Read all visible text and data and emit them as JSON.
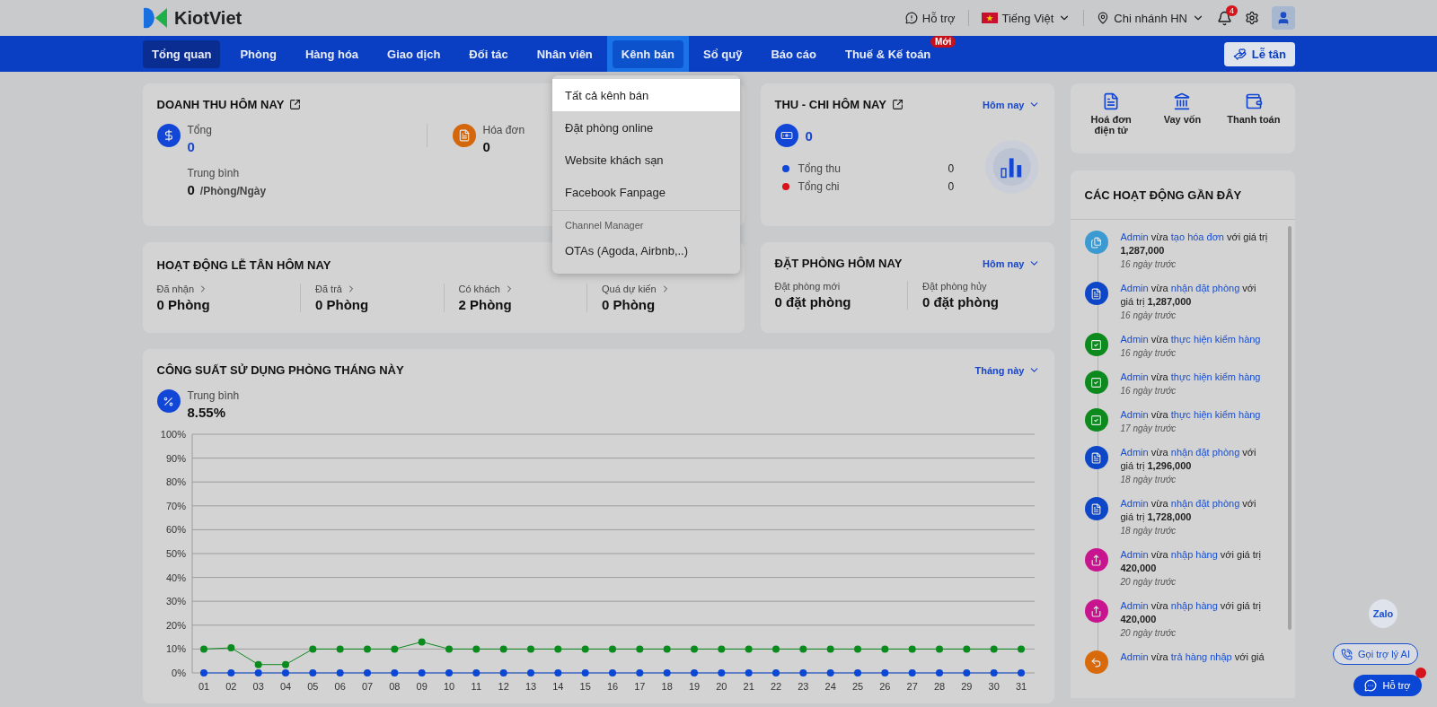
{
  "header": {
    "brand": "KiotViet",
    "support": "Hỗ trợ",
    "language": "Tiếng Việt",
    "branch": "Chi nhánh HN",
    "notifications": "4"
  },
  "nav": {
    "tabs": [
      {
        "label": "Tổng quan",
        "selected": true,
        "open": false
      },
      {
        "label": "Phòng",
        "selected": false,
        "open": false
      },
      {
        "label": "Hàng hóa",
        "selected": false,
        "open": false
      },
      {
        "label": "Giao dịch",
        "selected": false,
        "open": false
      },
      {
        "label": "Đối tác",
        "selected": false,
        "open": false
      },
      {
        "label": "Nhân viên",
        "selected": false,
        "open": false
      },
      {
        "label": "Kênh bán",
        "selected": false,
        "open": true
      },
      {
        "label": "Sổ quỹ",
        "selected": false,
        "open": false
      },
      {
        "label": "Báo cáo",
        "selected": false,
        "open": false
      },
      {
        "label": "Thuế & Kế toán",
        "selected": false,
        "open": false,
        "badge": "Mới"
      }
    ],
    "reception_button": "Lễ tân"
  },
  "dropdown": {
    "items": [
      {
        "kind": "item",
        "label": "Tất cả kênh bán",
        "selected": true
      },
      {
        "kind": "item",
        "label": "Đặt phòng online",
        "selected": false
      },
      {
        "kind": "item",
        "label": "Website khách sạn",
        "selected": false
      },
      {
        "kind": "item",
        "label": "Facebook Fanpage",
        "selected": false
      },
      {
        "kind": "section",
        "label": "Channel Manager"
      },
      {
        "kind": "item",
        "label": "OTAs (Agoda, Airbnb,..)",
        "selected": false
      }
    ]
  },
  "revenue": {
    "title": "DOANH THU HÔM NAY",
    "total_label": "Tổng",
    "total": "0",
    "invoice_label": "Hóa đơn",
    "invoice": "0",
    "average_label": "Trung bình",
    "average": "0",
    "average_unit": "/Phòng/Ngày"
  },
  "reception": {
    "title": "HOẠT ĐỘNG LỄ TÂN HÔM NAY",
    "stats": [
      {
        "label": "Đã nhận",
        "value": "0 Phòng"
      },
      {
        "label": "Đã trả",
        "value": "0 Phòng"
      },
      {
        "label": "Có khách",
        "value": "2 Phòng"
      },
      {
        "label": "Quá dự kiến",
        "value": "0 Phòng"
      }
    ]
  },
  "cashflow": {
    "title": "THU - CHI HÔM NAY",
    "period": "Hôm nay",
    "amount": "0",
    "rows": [
      {
        "label": "Tổng thu",
        "value": "0",
        "color": "#1146d6"
      },
      {
        "label": "Tổng chi",
        "value": "0",
        "color": "#d8141b"
      }
    ]
  },
  "bookings": {
    "title": "ĐẶT PHÒNG HÔM NAY",
    "period": "Hôm nay",
    "stats": [
      {
        "label": "Đặt phòng mới",
        "value": "0 đặt phòng"
      },
      {
        "label": "Đặt phòng hủy",
        "value": "0 đặt phòng"
      }
    ]
  },
  "occupancy": {
    "title": "CÔNG SUẤT SỬ DỤNG PHÒNG THÁNG NÀY",
    "period": "Tháng này",
    "average_label": "Trung bình",
    "average": "8.55%",
    "chart_data": {
      "type": "line",
      "grid": true,
      "categories": [
        "01",
        "02",
        "03",
        "04",
        "05",
        "06",
        "07",
        "08",
        "09",
        "10",
        "11",
        "12",
        "13",
        "14",
        "15",
        "16",
        "17",
        "18",
        "19",
        "20",
        "21",
        "22",
        "23",
        "24",
        "25",
        "26",
        "27",
        "28",
        "29",
        "30",
        "31"
      ],
      "ylim": [
        0,
        100
      ],
      "yticks": [
        {
          "value": 0,
          "label": "0%"
        },
        {
          "value": 10,
          "label": "10%"
        },
        {
          "value": 20,
          "label": "20%"
        },
        {
          "value": 30,
          "label": "30%"
        },
        {
          "value": 40,
          "label": "40%"
        },
        {
          "value": 50,
          "label": "50%"
        },
        {
          "value": 60,
          "label": "60%"
        },
        {
          "value": 70,
          "label": "70%"
        },
        {
          "value": 80,
          "label": "80%"
        },
        {
          "value": 90,
          "label": "90%"
        },
        {
          "value": 100,
          "label": "100%"
        }
      ],
      "series": [
        {
          "color": "#0b8a1e",
          "marker": true,
          "values": [
            10,
            10.5,
            3.5,
            3.5,
            10,
            10,
            10,
            10,
            13,
            10,
            10,
            10,
            10,
            10,
            10,
            10,
            10,
            10,
            10,
            10,
            10,
            10,
            10,
            10,
            10,
            10,
            10,
            10,
            10,
            10,
            10
          ]
        },
        {
          "color": "#0a47d4",
          "marker": true,
          "values": [
            0,
            0,
            0,
            0,
            0,
            0,
            0,
            0,
            0,
            0,
            0,
            0,
            0,
            0,
            0,
            0,
            0,
            0,
            0,
            0,
            0,
            0,
            0,
            0,
            0,
            0,
            0,
            0,
            0,
            0,
            0
          ]
        }
      ]
    }
  },
  "shortcuts": [
    {
      "kind": "einvoice",
      "label": "Hoá đơn điện tử"
    },
    {
      "kind": "loan",
      "label": "Vay vốn"
    },
    {
      "kind": "payment",
      "label": "Thanh toán"
    }
  ],
  "activities": {
    "title": "CÁC HOẠT ĐỘNG GẦN ĐÂY",
    "items": [
      {
        "kind": "invoice",
        "parts": [
          {
            "kind": "link",
            "text": "Admin"
          },
          {
            "kind": "plain",
            "text": " vừa "
          },
          {
            "kind": "link",
            "text": "tạo hóa đơn"
          },
          {
            "kind": "plain",
            "text": " với giá trị "
          },
          {
            "kind": "value",
            "text": "1,287,000"
          }
        ],
        "time": "16 ngày trước"
      },
      {
        "kind": "booking",
        "parts": [
          {
            "kind": "link",
            "text": "Admin"
          },
          {
            "kind": "plain",
            "text": " vừa "
          },
          {
            "kind": "link",
            "text": "nhận đặt phòng"
          },
          {
            "kind": "plain",
            "text": " với giá trị "
          },
          {
            "kind": "value",
            "text": "1,287,000"
          }
        ],
        "time": "16 ngày trước"
      },
      {
        "kind": "check",
        "parts": [
          {
            "kind": "link",
            "text": "Admin"
          },
          {
            "kind": "plain",
            "text": " vừa "
          },
          {
            "kind": "link",
            "text": "thực hiện kiểm hàng"
          }
        ],
        "time": "16 ngày trước"
      },
      {
        "kind": "check",
        "parts": [
          {
            "kind": "link",
            "text": "Admin"
          },
          {
            "kind": "plain",
            "text": " vừa "
          },
          {
            "kind": "link",
            "text": "thực hiện kiểm hàng"
          }
        ],
        "time": "16 ngày trước"
      },
      {
        "kind": "check",
        "parts": [
          {
            "kind": "link",
            "text": "Admin"
          },
          {
            "kind": "plain",
            "text": " vừa "
          },
          {
            "kind": "link",
            "text": "thực hiện kiểm hàng"
          }
        ],
        "time": "17 ngày trước"
      },
      {
        "kind": "booking",
        "parts": [
          {
            "kind": "link",
            "text": "Admin"
          },
          {
            "kind": "plain",
            "text": " vừa "
          },
          {
            "kind": "link",
            "text": "nhận đặt phòng"
          },
          {
            "kind": "plain",
            "text": " với giá trị "
          },
          {
            "kind": "value",
            "text": "1,296,000"
          }
        ],
        "time": "18 ngày trước"
      },
      {
        "kind": "booking",
        "parts": [
          {
            "kind": "link",
            "text": "Admin"
          },
          {
            "kind": "plain",
            "text": " vừa "
          },
          {
            "kind": "link",
            "text": "nhận đặt phòng"
          },
          {
            "kind": "plain",
            "text": " với giá trị "
          },
          {
            "kind": "value",
            "text": "1,728,000"
          }
        ],
        "time": "18 ngày trước"
      },
      {
        "kind": "import",
        "parts": [
          {
            "kind": "link",
            "text": "Admin"
          },
          {
            "kind": "plain",
            "text": " vừa "
          },
          {
            "kind": "link",
            "text": "nhập hàng"
          },
          {
            "kind": "plain",
            "text": " với giá trị "
          },
          {
            "kind": "value",
            "text": "420,000"
          }
        ],
        "time": "20 ngày trước"
      },
      {
        "kind": "import",
        "parts": [
          {
            "kind": "link",
            "text": "Admin"
          },
          {
            "kind": "plain",
            "text": " vừa "
          },
          {
            "kind": "link",
            "text": "nhập hàng"
          },
          {
            "kind": "plain",
            "text": " với giá trị "
          },
          {
            "kind": "value",
            "text": "420,000"
          }
        ],
        "time": "20 ngày trước"
      },
      {
        "kind": "return",
        "parts": [
          {
            "kind": "link",
            "text": "Admin"
          },
          {
            "kind": "plain",
            "text": " vừa "
          },
          {
            "kind": "link",
            "text": "trả hàng nhập"
          },
          {
            "kind": "plain",
            "text": " với giá"
          }
        ]
      }
    ]
  },
  "floating": {
    "zalo": "Zalo",
    "ai_button": "Gọi trợ lý AI",
    "support_button": "Hỗ trợ"
  }
}
